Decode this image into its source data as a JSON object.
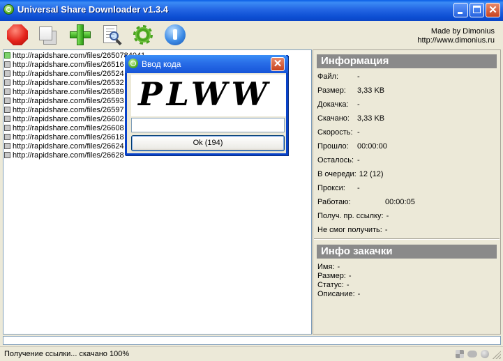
{
  "window": {
    "title": "Universal Share Downloader v1.3.4",
    "close_glyph": "✕"
  },
  "toolbar": {
    "tools": [
      {
        "icon": "stop-icon"
      },
      {
        "icon": "copy-icon"
      },
      {
        "icon": "add-icon"
      },
      {
        "icon": "search-document-icon"
      },
      {
        "icon": "settings-gear-icon"
      },
      {
        "icon": "info-icon"
      }
    ],
    "made_by": "Made by Dimonius",
    "site": "http://www.dimonius.ru"
  },
  "links": [
    {
      "url": "http://rapidshare.com/files/2650784041",
      "state": "active"
    },
    {
      "url": "http://rapidshare.com/files/26516",
      "state": "waiting"
    },
    {
      "url": "http://rapidshare.com/files/26524",
      "state": "waiting"
    },
    {
      "url": "http://rapidshare.com/files/26532",
      "state": "waiting"
    },
    {
      "url": "http://rapidshare.com/files/26589",
      "state": "waiting"
    },
    {
      "url": "http://rapidshare.com/files/26593",
      "state": "waiting"
    },
    {
      "url": "http://rapidshare.com/files/26597",
      "state": "waiting"
    },
    {
      "url": "http://rapidshare.com/files/26602",
      "state": "waiting"
    },
    {
      "url": "http://rapidshare.com/files/26608",
      "state": "waiting"
    },
    {
      "url": "http://rapidshare.com/files/26618",
      "state": "waiting"
    },
    {
      "url": "http://rapidshare.com/files/26624",
      "state": "waiting"
    },
    {
      "url": "http://rapidshare.com/files/26628",
      "state": "waiting"
    }
  ],
  "info": {
    "header": "Информация",
    "rows": [
      {
        "label": "Файл:",
        "value": "-"
      },
      {
        "label": "Размер:",
        "value": "3,33 KB"
      },
      {
        "label": "Докачка:",
        "value": "-"
      },
      {
        "label": "Скачано:",
        "value": "3,33 KB"
      },
      {
        "label": "Скорость:",
        "value": "-"
      },
      {
        "label": "Прошло:",
        "value": "00:00:00"
      },
      {
        "label": "Осталось:",
        "value": "-"
      },
      {
        "label": "В очереди:",
        "value": "12 (12)"
      },
      {
        "label": "Прокси:",
        "value": "-"
      },
      {
        "label": "Работаю:",
        "value": "00:00:05"
      },
      {
        "label": "Получ. пр. ссылку:",
        "value": "-"
      },
      {
        "label": "Не смог получить:",
        "value": "-"
      }
    ]
  },
  "download_info": {
    "header": "Инфо закачки",
    "rows": [
      {
        "label": "Имя:",
        "value": "-"
      },
      {
        "label": "Размер:",
        "value": "-"
      },
      {
        "label": "Статус:",
        "value": "-"
      },
      {
        "label": "Описание:",
        "value": "-"
      }
    ]
  },
  "progress": {
    "value": 0
  },
  "status": {
    "text": "Получение ссылки... скачано 100%",
    "icons": [
      "tools-icon",
      "network-icon",
      "indicator-icon"
    ]
  },
  "dialog": {
    "title": "Ввод кода",
    "captcha_text": "PLWW",
    "input_value": "",
    "ok_label": "Ok (194)"
  },
  "colors": {
    "titlebar": "#0A5EE6",
    "section_header": "#8a8a8a",
    "window_bg": "#ECE9D8",
    "active_link": "#7dd46b"
  }
}
